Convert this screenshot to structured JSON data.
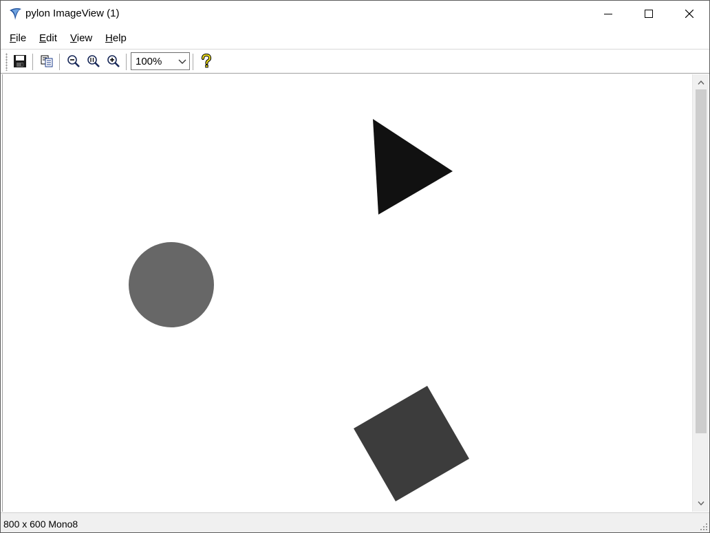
{
  "window": {
    "title": "pylon ImageView (1)"
  },
  "menu": {
    "file": {
      "key": "F",
      "rest": "ile"
    },
    "edit": {
      "key": "E",
      "rest": "dit"
    },
    "view": {
      "key": "V",
      "rest": "iew"
    },
    "help": {
      "key": "H",
      "rest": "elp"
    }
  },
  "toolbar": {
    "zoom_value": "100%",
    "icons": [
      "save-icon",
      "copy-icon",
      "zoom-out-icon",
      "zoom-fit-icon",
      "zoom-in-icon",
      "help-icon"
    ]
  },
  "image": {
    "shapes": [
      {
        "shape": "triangle",
        "fill": "#111111"
      },
      {
        "shape": "circle",
        "fill": "#676767"
      },
      {
        "shape": "square",
        "fill": "#3c3c3c"
      }
    ]
  },
  "status": {
    "text": "800 x 600 Mono8"
  },
  "colors": {
    "window_bg": "#ffffff",
    "chrome_bg": "#f0f0f0",
    "scroll_thumb": "#cdcdcd"
  }
}
